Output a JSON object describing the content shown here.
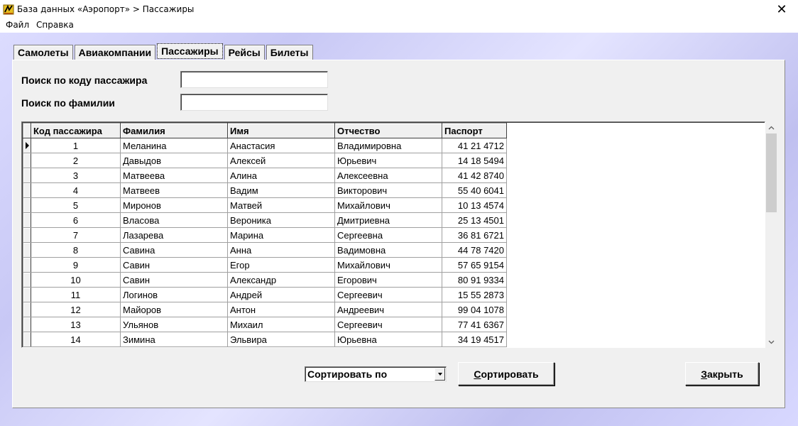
{
  "window": {
    "title": "База данных «Аэропорт» > Пассажиры",
    "close_glyph": "✕"
  },
  "menu": {
    "items": [
      "Файл",
      "Справка"
    ]
  },
  "tabs": [
    {
      "label": "Самолеты",
      "active": false
    },
    {
      "label": "Авиакомпании",
      "active": false
    },
    {
      "label": "Пассажиры",
      "active": true
    },
    {
      "label": "Рейсы",
      "active": false
    },
    {
      "label": "Билеты",
      "active": false
    }
  ],
  "search": {
    "by_code_label": "Поиск по коду пассажира",
    "by_code_value": "",
    "by_surname_label": "Поиск по фамилии",
    "by_surname_value": ""
  },
  "table": {
    "columns": [
      "Код пассажира",
      "Фамилия",
      "Имя",
      "Отчество",
      "Паспорт"
    ],
    "selected_row": 0,
    "rows": [
      [
        "1",
        "Меланина",
        "Анастасия",
        "Владимировна",
        "41 21 4712"
      ],
      [
        "2",
        "Давыдов",
        "Алексей",
        "Юрьевич",
        "14 18 5494"
      ],
      [
        "3",
        "Матвеева",
        "Алина",
        "Алексеевна",
        "41 42 8740"
      ],
      [
        "4",
        "Матвеев",
        "Вадим",
        "Викторович",
        "55 40 6041"
      ],
      [
        "5",
        "Миронов",
        "Матвей",
        "Михайлович",
        "10 13 4574"
      ],
      [
        "6",
        "Власова",
        "Вероника",
        "Дмитриевна",
        "25 13 4501"
      ],
      [
        "7",
        "Лазарева",
        "Марина",
        "Сергеевна",
        "36 81 6721"
      ],
      [
        "8",
        "Савина",
        "Анна",
        "Вадимовна",
        "44 78 7420"
      ],
      [
        "9",
        "Савин",
        "Егор",
        "Михайлович",
        "57 65 9154"
      ],
      [
        "10",
        "Савин",
        "Александр",
        "Егорович",
        "80 91 9334"
      ],
      [
        "11",
        "Логинов",
        "Андрей",
        "Сергеевич",
        "15 55 2873"
      ],
      [
        "12",
        "Майоров",
        "Антон",
        "Андреевич",
        "99 04 1078"
      ],
      [
        "13",
        "Ульянов",
        "Михаил",
        "Сергеевич",
        "77 41 6367"
      ],
      [
        "14",
        "Зимина",
        "Эльвира",
        "Юрьевна",
        "34 19 4517"
      ]
    ]
  },
  "sort": {
    "combo_value": "Сортировать по",
    "sort_button_label": "Сортировать",
    "close_button_label": "Закрыть"
  },
  "icons": {
    "app": "app-icon",
    "scroll_up": "chevron-up-icon",
    "scroll_down": "chevron-down-icon",
    "combo_dropdown": "triangle-down-icon",
    "row_indicator": "triangle-right-icon"
  }
}
